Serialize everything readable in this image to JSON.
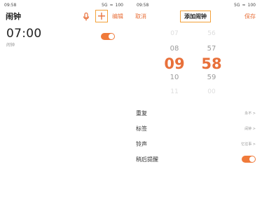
{
  "left": {
    "status": {
      "time": "09:58",
      "signal": "5G",
      "wifi": "≈",
      "battery": "100"
    },
    "header": {
      "title": "闹钟",
      "edit": "编辑"
    },
    "alarm": {
      "time": "07:00",
      "label": "闹钟",
      "enabled": true
    }
  },
  "right": {
    "status": {
      "time": "09:58",
      "signal": "5G",
      "wifi": "≈",
      "battery": "100"
    },
    "header": {
      "cancel": "取消",
      "title": "添加闹钟",
      "save": "保存"
    },
    "picker": {
      "hours": [
        "07",
        "08",
        "09",
        "10",
        "11"
      ],
      "minutes": [
        "56",
        "57",
        "58",
        "59",
        "00"
      ],
      "selected_hour": "09",
      "selected_minute": "58"
    },
    "settings": [
      {
        "label": "重复",
        "value": "永不 >"
      },
      {
        "label": "标签",
        "value": "闹钟 >"
      },
      {
        "label": "铃声",
        "value": "忆往事 >"
      },
      {
        "label": "稍后提醒",
        "value": "",
        "toggle": true
      }
    ]
  },
  "colors": {
    "accent": "#e8703a",
    "highlight_border": "#f3a13a"
  },
  "icons": [
    "mic-icon",
    "add-icon",
    "signal-icon",
    "wifi-icon",
    "battery-icon"
  ]
}
